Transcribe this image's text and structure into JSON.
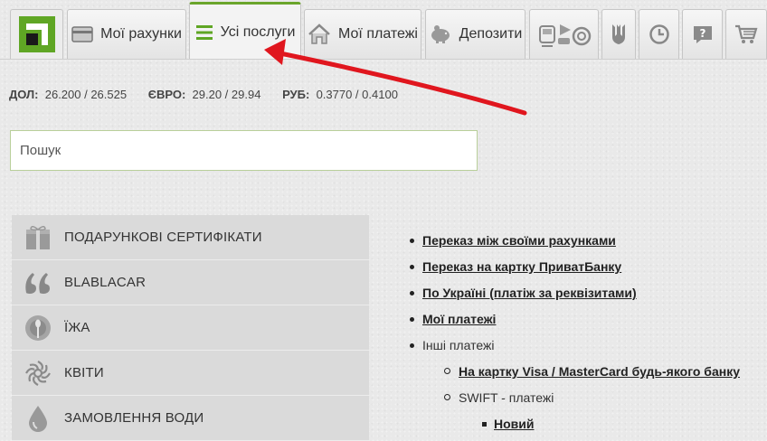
{
  "nav": {
    "tabs": [
      {
        "id": "logo",
        "icon": "privatbank-logo-icon"
      },
      {
        "id": "accounts",
        "label": "Мої рахунки",
        "icon": "card-icon"
      },
      {
        "id": "services",
        "label": "Усі послуги",
        "icon": "list-icon",
        "active": true
      },
      {
        "id": "payments",
        "label": "Мої платежі",
        "icon": "home-icon"
      },
      {
        "id": "deposits",
        "label": "Депозити",
        "icon": "piggy-bank-icon"
      },
      {
        "id": "travel",
        "icon": "transport-icon"
      },
      {
        "id": "gov",
        "icon": "trident-icon"
      },
      {
        "id": "history",
        "icon": "history-icon"
      },
      {
        "id": "help",
        "icon": "help-icon"
      },
      {
        "id": "shop",
        "icon": "cart-icon"
      }
    ],
    "accent_color": "#6aa52b"
  },
  "rates": [
    {
      "label": "ДОЛ:",
      "value": "26.200 / 26.525"
    },
    {
      "label": "ЄВРО:",
      "value": "29.20 / 29.94"
    },
    {
      "label": "РУБ:",
      "value": "0.3770 / 0.4100"
    }
  ],
  "search": {
    "placeholder": "Пошук",
    "value": ""
  },
  "menu": [
    {
      "label": "ПОДАРУНКОВІ СЕРТИФІКАТИ",
      "icon": "gift-icon"
    },
    {
      "label": "BLABLACAR",
      "icon": "quote-icon"
    },
    {
      "label": "ЇЖА",
      "icon": "cutlery-icon"
    },
    {
      "label": "КВІТИ",
      "icon": "flower-icon"
    },
    {
      "label": "ЗАМОВЛЕННЯ ВОДИ",
      "icon": "water-drop-icon"
    }
  ],
  "links": {
    "own_transfer": "Переказ між своїми рахунками",
    "card_transfer": "Переказ на картку ПриватБанку",
    "ukraine": "По Україні (платіж за реквізитами)",
    "my_payments": "Мої платежі",
    "other": "Інші платежі",
    "visa_mc": "На картку Visa / MasterCard будь-якого банку",
    "swift": "SWIFT - платежі",
    "new": "Новий"
  },
  "annotation": {
    "arrow_color": "#e0161e"
  }
}
